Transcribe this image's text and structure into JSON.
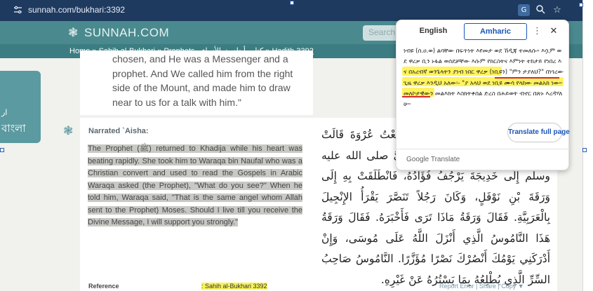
{
  "browser": {
    "url": "sunnah.com/bukhari:3392",
    "icons": [
      "site-settings-icon",
      "translate-icon",
      "zoom-icon",
      "bookmark-star-icon"
    ]
  },
  "site": {
    "logo": "SUNNAH.COM",
    "search_placeholder": "Search"
  },
  "breadcrumb": {
    "home": "Home",
    "sep1": " » ",
    "collection": "Sahih al-Bukhari",
    "sep2": " » ",
    "book": "Prophets - كتاب أحاديث الأنبياء",
    "sep3": " » ",
    "hadith_prefix": "Hadith ",
    "hadith_num": "3392"
  },
  "left_panel": {
    "line1": "ار",
    "line2": "বাংলা"
  },
  "previous_hadith_text": "chosen, and He was a Messenger and a prophet. And We called him from the right side of the Mount, and made him to draw near to us for a talk with him.\"",
  "hadith": {
    "narrated_by": "Narrated `Aisha:",
    "english": "The Prophet (ﷺ) returned to Khadija while his heart was beating rapidly. She took him to Waraqa bin Naufal who was a Christian convert and used to read the Gospels in Arabic Waraqa asked (the Prophet), \"What do you see?\" When he told him, Waraqa said, \"That is the same angel whom Allah sent to the Prophet) Moses. Should I live till you receive the Divine Message, I will support you strongly.\"",
    "arabic": "حَدَّثَنِي عُقَيْلٌ عَنْ ابْنِ شِهَابٍ سَمِعْتُ عُرْوَةَ قَالَتْ عَائِشَةُ رَضِيَ اللَّهُ عَنْهَا فَرَجَعَ النَّبِيُّ صلى الله عليه وسلم إِلَى خَدِيجَةَ يَرْجُفُ فُؤَادُهُ، فَانْطَلَقَتْ بِهِ إِلَى وَرَقَةَ بْنِ نَوْفَلٍ، وَكَانَ رَجُلاً تَنَصَّرَ يَقْرَأُ الإِنْجِيلَ بِالْعَرَبِيَّةِ. فَقَالَ وَرَقَةُ مَاذَا تَرَى فَأَخْبَرَهُ. فَقَالَ وَرَقَةُ هَذَا النَّامُوسُ الَّذِي أَنْزَلَ اللَّهُ عَلَى مُوسَى، وَإِنْ أَدْرَكَنِي يَوْمُكَ أَنْصُرْكَ نَصْرًا مُؤَزَّرًا. النَّامُوسُ صَاحِبُ السِّرِّ الَّذِي يُطْلِعُهُ بِمَا يَسْتُرُهُ عَنْ غَيْرِهِ.",
    "reference_label": "Reference",
    "reference_value": ": Sahih al-Bukhari 3392",
    "actions": "Report Error | Share | Copy ▼"
  },
  "translate_popup": {
    "tab_source": "English",
    "tab_target": "Amharic",
    "translation": "ነብዩ (ሰ.ዐ.ወ) ልባቸው በፍጥነት እየመታ ወደ ኸዲጃ ተመለሱ። እሷም ወደ ዋረቃ ቢን ኑፋል ወሰደቻቸው እሱም የክርስትና እምነት ተከታይ የነበረ እና በአረብኛ ወንጌላትን ያነብ ነበር ዋረቃ (ነቢዩን) \"ምን ታያለህ?\" በነገረው ጊዜ ዋረቃ እንዲህ አለው፡- \"ያ አላህ ወደ ነቢዩ ሙሳ የላከው መልአክ ነው። መለኮታዊውን መልእክት እስክትቀበል ድረስ በሕይወት ብኖር በጽኑ እረዳሃለሁ።",
    "translate_full_page": "Translate full page",
    "brand": "Google Translate",
    "menu_icon": "more-vert-icon",
    "close_icon": "close-icon"
  },
  "colors": {
    "header": "#4a8a8f",
    "crumb_bar": "#3b7d82",
    "highlight": "#fff24d",
    "accent_blue": "#1a56b8"
  }
}
